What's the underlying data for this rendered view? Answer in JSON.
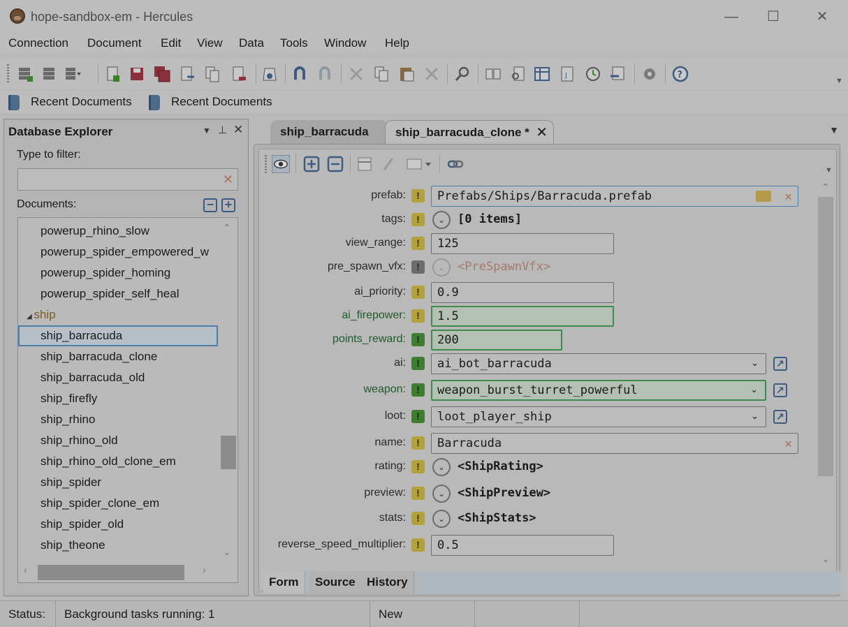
{
  "window": {
    "title": "hope-sandbox-em - Hercules",
    "minimize": "—",
    "maximize": "☐",
    "close": "✕"
  },
  "menu": [
    "Connection",
    "Document",
    "Edit",
    "View",
    "Data",
    "Tools",
    "Window",
    "Help"
  ],
  "recent": [
    "Recent Documents",
    "Recent Documents"
  ],
  "explorer": {
    "title": "Database Explorer",
    "filter_label": "Type to filter:",
    "filter_value": "",
    "documents_label": "Documents:",
    "items": [
      {
        "label": "powerup_rhino_slow",
        "type": "doc"
      },
      {
        "label": "powerup_spider_empowered_w",
        "type": "doc"
      },
      {
        "label": "powerup_spider_homing",
        "type": "doc"
      },
      {
        "label": "powerup_spider_self_heal",
        "type": "doc"
      },
      {
        "label": "ship",
        "type": "group"
      },
      {
        "label": "ship_barracuda",
        "type": "doc",
        "selected": true
      },
      {
        "label": "ship_barracuda_clone",
        "type": "doc"
      },
      {
        "label": "ship_barracuda_old",
        "type": "doc"
      },
      {
        "label": "ship_firefly",
        "type": "doc"
      },
      {
        "label": "ship_rhino",
        "type": "doc"
      },
      {
        "label": "ship_rhino_old",
        "type": "doc"
      },
      {
        "label": "ship_rhino_old_clone_em",
        "type": "doc"
      },
      {
        "label": "ship_spider",
        "type": "doc"
      },
      {
        "label": "ship_spider_clone_em",
        "type": "doc"
      },
      {
        "label": "ship_spider_old",
        "type": "doc"
      },
      {
        "label": "ship_theone",
        "type": "doc"
      }
    ]
  },
  "tabs": [
    {
      "label": "ship_barracuda",
      "active": false
    },
    {
      "label": "ship_barracuda_clone *",
      "active": true
    }
  ],
  "form": {
    "fields": [
      {
        "label": "prefab:",
        "badge": "yellow",
        "kind": "path",
        "value": "Prefabs/Ships/Barracuda.prefab",
        "modified": false
      },
      {
        "label": "tags:",
        "badge": "yellow",
        "kind": "list",
        "value": "[0 items]",
        "modified": false
      },
      {
        "label": "view_range:",
        "badge": "yellow",
        "kind": "number",
        "value": "125",
        "modified": false
      },
      {
        "label": "pre_spawn_vfx:",
        "badge": "gray",
        "kind": "object-disabled",
        "value": "<PreSpawnVfx>",
        "modified": false
      },
      {
        "label": "ai_priority:",
        "badge": "yellow",
        "kind": "number",
        "value": "0.9",
        "modified": false
      },
      {
        "label": "ai_firepower:",
        "badge": "yellow",
        "kind": "number",
        "value": "1.5",
        "modified": true
      },
      {
        "label": "points_reward:",
        "badge": "green",
        "kind": "number-short",
        "value": "200",
        "modified": true
      },
      {
        "label": "ai:",
        "badge": "green",
        "kind": "select",
        "value": "ai_bot_barracuda",
        "modified": false
      },
      {
        "label": "weapon:",
        "badge": "green",
        "kind": "select",
        "value": "weapon_burst_turret_powerful",
        "modified": true
      },
      {
        "label": "loot:",
        "badge": "green",
        "kind": "select",
        "value": "loot_player_ship",
        "modified": false
      },
      {
        "label": "name:",
        "badge": "yellow",
        "kind": "text",
        "value": "Barracuda",
        "modified": false
      },
      {
        "label": "rating:",
        "badge": "yellow",
        "kind": "object",
        "value": "<ShipRating>",
        "modified": false
      },
      {
        "label": "preview:",
        "badge": "yellow",
        "kind": "object",
        "value": "<ShipPreview>",
        "modified": false
      },
      {
        "label": "stats:",
        "badge": "yellow",
        "kind": "object",
        "value": "<ShipStats>",
        "modified": false
      },
      {
        "label": "reverse_speed_multiplier:",
        "badge": "yellow",
        "kind": "number",
        "value": "0.5",
        "modified": false
      }
    ],
    "bottom_tabs": [
      "Form",
      "Source",
      "History"
    ],
    "active_bottom_tab": "Form"
  },
  "status": {
    "label": "Status:",
    "message": "Background tasks running: 1",
    "state": "New"
  },
  "colors": {
    "badge_yellow": "#b3a23a",
    "badge_green": "#3f7d31",
    "modified_border": "#3f8a4e",
    "link_blue": "#3e5b82"
  }
}
